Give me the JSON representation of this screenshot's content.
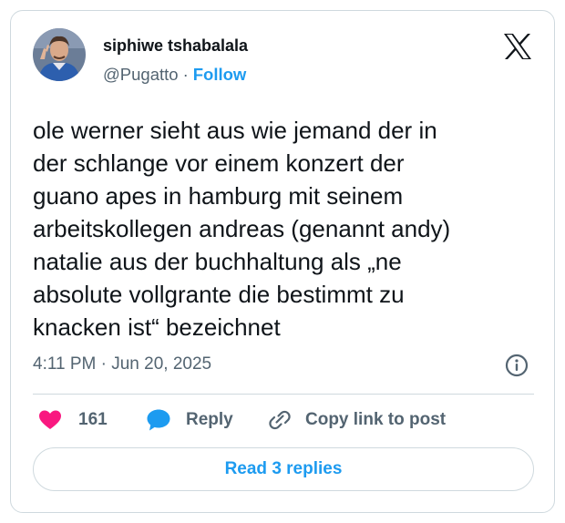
{
  "author": {
    "display_name": "siphiwe tshabalala",
    "handle": "@Pugatto",
    "separator": "·",
    "follow_label": "Follow"
  },
  "tweet": {
    "lines": [
      "ole werner sieht aus wie jemand der in",
      "der schlange vor einem konzert der",
      "guano apes in hamburg mit seinem",
      "arbeitskollegen andreas (genannt andy)",
      "natalie aus der buchhaltung als „ne",
      "absolute vollgrante die bestimmt zu",
      "knacken ist“ bezeichnet"
    ],
    "timestamp": "4:11 PM · Jun 20, 2025"
  },
  "actions": {
    "like_count": "161",
    "reply_label": "Reply",
    "copy_link_label": "Copy link to post"
  },
  "read_replies_label": "Read 3 replies",
  "icons": {
    "logo": "x-logo-icon",
    "info": "info-icon",
    "like": "heart-icon",
    "reply": "speech-bubble-icon",
    "copy": "link-icon"
  },
  "colors": {
    "accent": "#1d9bf0",
    "like": "#f91880",
    "muted_text": "#536471",
    "border": "#cfd9de"
  }
}
